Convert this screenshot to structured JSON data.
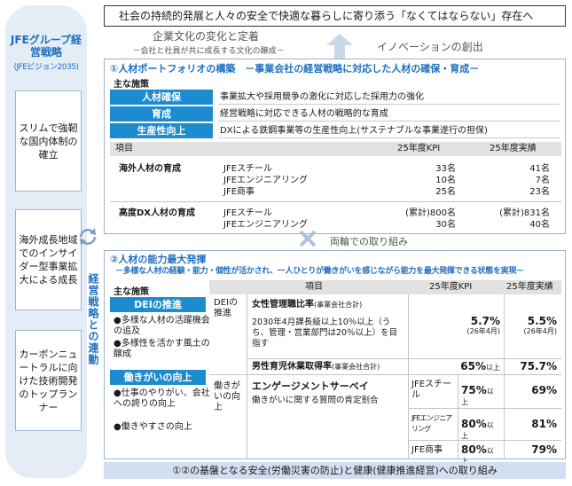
{
  "left": {
    "title": "JFEグループ経営戦略",
    "subtitle": "(JFEビジョン2035)",
    "boxes": [
      "スリムで強靭な国内体制の確立",
      "海外成長地域でのインサイダー型事業拡大による成長",
      "カーボンニュートラルに向けた技術開発のトップランナー"
    ],
    "vertical_label": "経営戦略との連動"
  },
  "header": {
    "mission": "社会の持続的発展と人々の安全で快適な暮らしに寄り添う「なくてはならない」存在へ",
    "culture": "企業文化の変化と定着",
    "culture_sub": "－会社と社員が共に成長する文化の醸成－",
    "innovation": "イノベーションの創出"
  },
  "section1": {
    "title": "①人材ポートフォリオの構築　－事業会社の経営戦略に対応した人材の確保・育成－",
    "main_label": "主な施策",
    "measures": [
      {
        "label": "人材確保",
        "desc": "事業拡大や採用競争の激化に対応した採用力の強化"
      },
      {
        "label": "育成",
        "desc": "経営戦略に対応できる人材の戦略的な育成"
      },
      {
        "label": "生産性向上",
        "desc": "DXによる鉄鋼事業等の生産性向上(サステナブルな事業遂行の担保)"
      }
    ],
    "table_header": {
      "item": "項目",
      "kpi": "25年度KPI",
      "actual": "25年度実績"
    },
    "groups": [
      {
        "name": "海外人材の育成",
        "rows": [
          {
            "company": "JFEスチール",
            "kpi": "33名",
            "actual": "41名"
          },
          {
            "company": "JFEエンジニアリング",
            "kpi": "10名",
            "actual": "7名"
          },
          {
            "company": "JFE商事",
            "kpi": "25名",
            "actual": "23名"
          }
        ]
      },
      {
        "name": "高度DX人材の育成",
        "rows": [
          {
            "company": "JFEスチール",
            "kpi": "(累計)800名",
            "actual": "(累計)831名"
          },
          {
            "company": "JFEエンジニアリング",
            "kpi": "30名",
            "actual": "40名"
          }
        ]
      }
    ]
  },
  "bridge": "両輪での取り組み",
  "section2": {
    "title": "②人材の能力最大発揮",
    "subtitle": "－多様な人材の経験・能力・個性が活かされ、一人ひとりが働きがいを感じながら能力を最大発揮できる状態を実現－",
    "main_label": "主な施策",
    "measures": [
      {
        "label": "DEIの推進",
        "bullets": [
          "●多様な人材の活躍機会の追及",
          "●多様性を活かす風土の醸成"
        ]
      },
      {
        "label": "働きがいの向上",
        "bullets": [
          "●仕事のやりがい、会社への誇りの向上",
          "●働きやすさの向上"
        ]
      }
    ],
    "table_header": {
      "item": "項目",
      "kpi": "25年度KPI",
      "actual": "25年度実績"
    },
    "dei": {
      "group": "DEIの推進",
      "women_title": "女性管理職比率",
      "women_note": "(事業会社合計)",
      "women_desc": "2030年4月課長級以上10％以上（うち、管理・営業部門は20％以上）を目指す",
      "women_kpi": "5.7%",
      "women_kpi_note": "(26年4月)",
      "women_actual": "5.5%",
      "women_actual_note": "(26年4月)",
      "men_title": "男性育児休業取得率",
      "men_note": "(事業会社合計)",
      "men_kpi": "65%",
      "men_actual": "75.7%",
      "above": "以上"
    },
    "engage": {
      "group": "働きがいの向上",
      "title": "エンゲージメントサーベイ",
      "desc": "働きがいに関する質問の肯定割合",
      "rows": [
        {
          "company": "JFEスチール",
          "kpi": "75%",
          "actual": "69%"
        },
        {
          "company": "JFEエンジニアリング",
          "kpi": "80%",
          "actual": "81%"
        },
        {
          "company": "JFE商事",
          "kpi": "80%",
          "actual": "79%"
        }
      ]
    }
  },
  "footer": "①②の基盤となる安全(労働災害の防止)と健康(健康推進経営)への取り組み"
}
